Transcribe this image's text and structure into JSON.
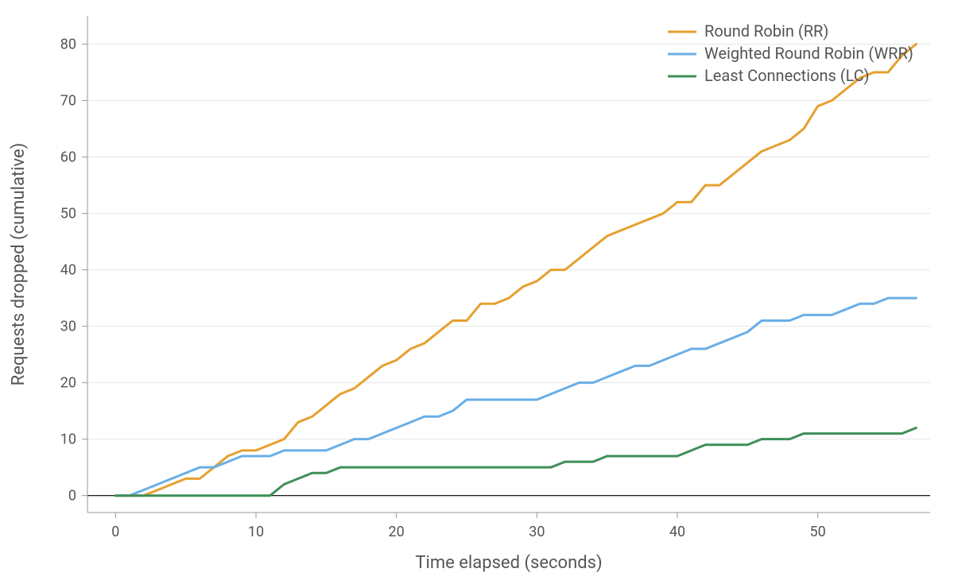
{
  "chart_data": {
    "type": "line",
    "title": "",
    "xlabel": "Time elapsed (seconds)",
    "ylabel": "Requests dropped (cumulative)",
    "xlim": [
      -2,
      58
    ],
    "ylim": [
      -3,
      85
    ],
    "x_ticks": [
      0,
      10,
      20,
      30,
      40,
      50
    ],
    "y_ticks": [
      0,
      10,
      20,
      30,
      40,
      50,
      60,
      70,
      80
    ],
    "grid": {
      "x": false,
      "y": true
    },
    "legend": {
      "position": "top-right"
    },
    "x": [
      0,
      1,
      2,
      3,
      4,
      5,
      6,
      7,
      8,
      9,
      10,
      11,
      12,
      13,
      14,
      15,
      16,
      17,
      18,
      19,
      20,
      21,
      22,
      23,
      24,
      25,
      26,
      27,
      28,
      29,
      30,
      31,
      32,
      33,
      34,
      35,
      36,
      37,
      38,
      39,
      40,
      41,
      42,
      43,
      44,
      45,
      46,
      47,
      48,
      49,
      50,
      51,
      52,
      53,
      54,
      55,
      56,
      57
    ],
    "series": [
      {
        "name": "Round Robin (RR)",
        "color": "#e6a02e",
        "values": [
          0,
          0,
          0,
          1,
          2,
          3,
          3,
          5,
          7,
          8,
          8,
          9,
          10,
          13,
          14,
          16,
          18,
          19,
          21,
          23,
          24,
          26,
          27,
          29,
          31,
          31,
          34,
          34,
          35,
          37,
          38,
          40,
          40,
          42,
          44,
          46,
          47,
          48,
          49,
          50,
          52,
          52,
          55,
          55,
          57,
          59,
          61,
          62,
          63,
          65,
          69,
          70,
          72,
          74,
          75,
          75,
          78,
          80
        ]
      },
      {
        "name": "Weighted Round Robin (WRR)",
        "color": "#6aaee6",
        "values": [
          0,
          0,
          1,
          2,
          3,
          4,
          5,
          5,
          6,
          7,
          7,
          7,
          8,
          8,
          8,
          8,
          9,
          10,
          10,
          11,
          12,
          13,
          14,
          14,
          15,
          17,
          17,
          17,
          17,
          17,
          17,
          18,
          19,
          20,
          20,
          21,
          22,
          23,
          23,
          24,
          25,
          26,
          26,
          27,
          28,
          29,
          31,
          31,
          31,
          32,
          32,
          32,
          33,
          34,
          34,
          35,
          35,
          35
        ]
      },
      {
        "name": "Least Connections (LC)",
        "color": "#3e8f58",
        "values": [
          0,
          0,
          0,
          0,
          0,
          0,
          0,
          0,
          0,
          0,
          0,
          0,
          2,
          3,
          4,
          4,
          5,
          5,
          5,
          5,
          5,
          5,
          5,
          5,
          5,
          5,
          5,
          5,
          5,
          5,
          5,
          5,
          6,
          6,
          6,
          7,
          7,
          7,
          7,
          7,
          7,
          8,
          9,
          9,
          9,
          9,
          10,
          10,
          10,
          11,
          11,
          11,
          11,
          11,
          11,
          11,
          11,
          12
        ]
      }
    ]
  },
  "labels": {
    "xlabel": "Time elapsed (seconds)",
    "ylabel": "Requests dropped (cumulative)",
    "legend": {
      "rr": "Round Robin (RR)",
      "wrr": "Weighted Round Robin (WRR)",
      "lc": "Least Connections (LC)"
    },
    "x_ticks": {
      "t0": "0",
      "t10": "10",
      "t20": "20",
      "t30": "30",
      "t40": "40",
      "t50": "50"
    },
    "y_ticks": {
      "t0": "0",
      "t10": "10",
      "t20": "20",
      "t30": "30",
      "t40": "40",
      "t50": "50",
      "t60": "60",
      "t70": "70",
      "t80": "80"
    }
  }
}
